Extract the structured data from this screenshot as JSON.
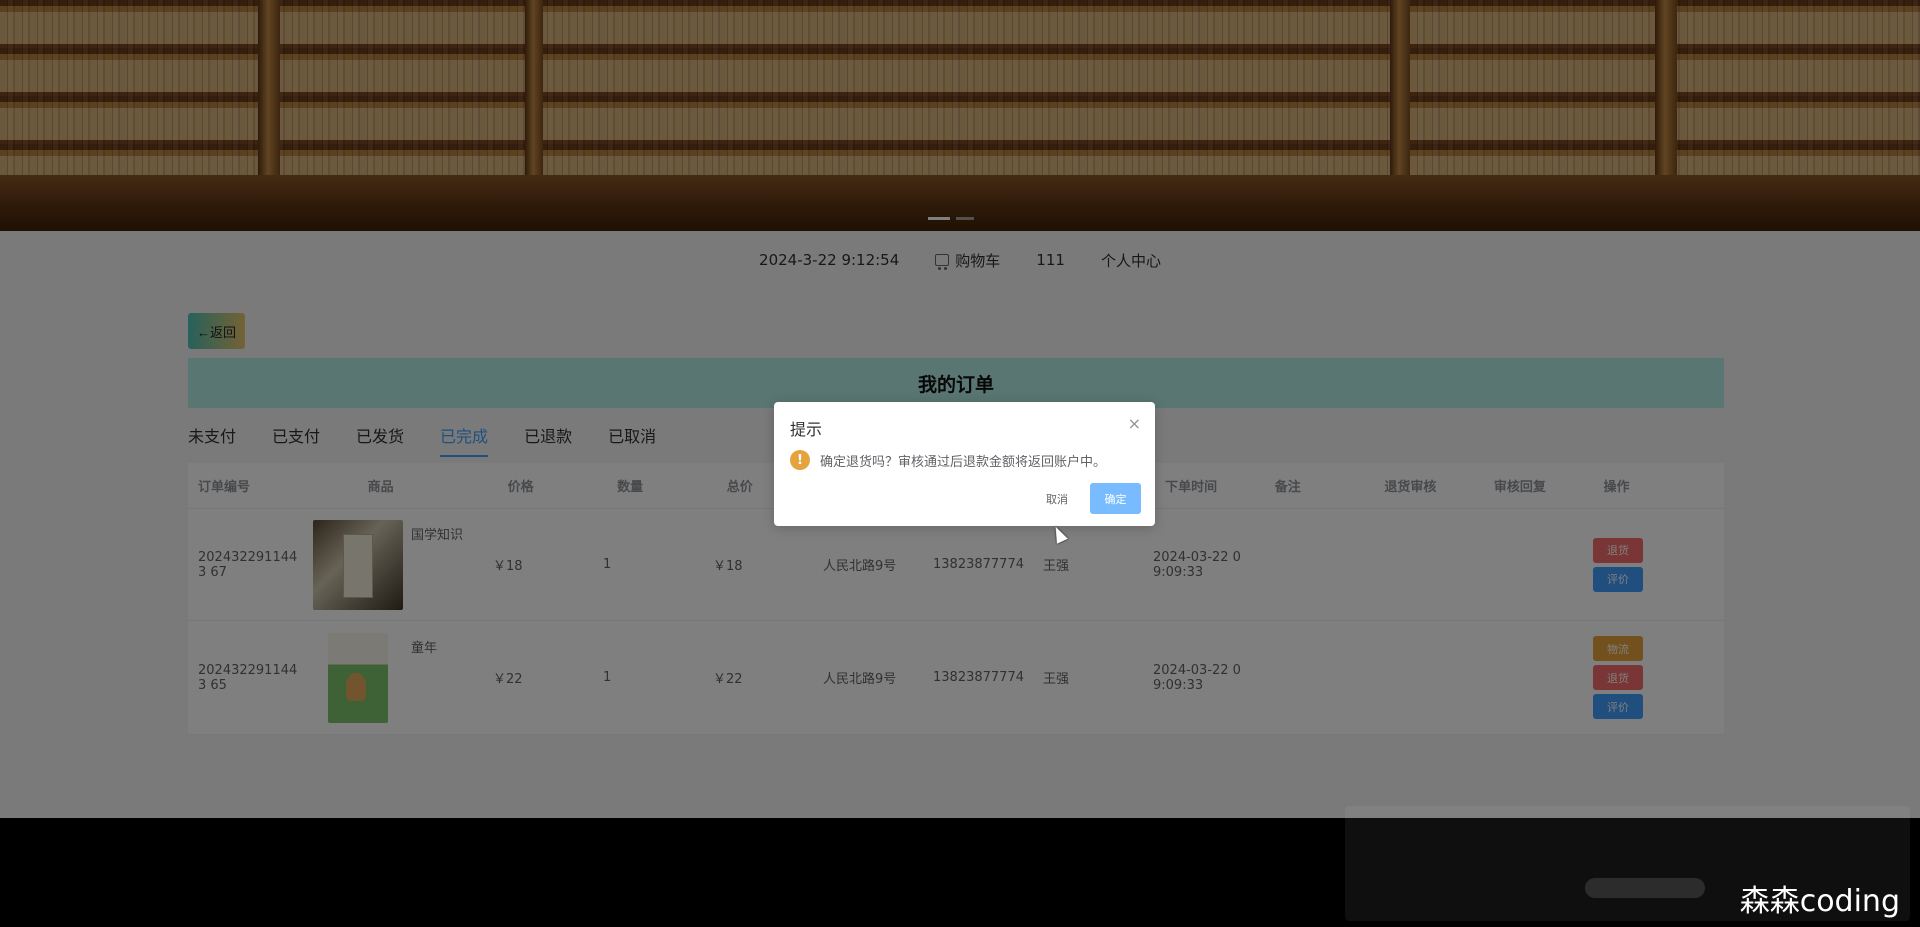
{
  "header": {
    "datetime": "2024-3-22 9:12:54",
    "cart_label": "购物车",
    "username": "111",
    "profile_label": "个人中心"
  },
  "back_label": "←返回",
  "page_title": "我的订单",
  "tabs": [
    {
      "label": "未支付",
      "active": false
    },
    {
      "label": "已支付",
      "active": false
    },
    {
      "label": "已发货",
      "active": false
    },
    {
      "label": "已完成",
      "active": true
    },
    {
      "label": "已退款",
      "active": false
    },
    {
      "label": "已取消",
      "active": false
    }
  ],
  "table": {
    "headers": [
      "订单编号",
      "商品",
      "价格",
      "数量",
      "总价",
      "",
      "",
      "",
      "下单时间",
      "备注",
      "退货审核",
      "审核回复",
      "操作"
    ],
    "rows": [
      {
        "order_no": "2024322911443 67",
        "goods": "国学知识",
        "price": "￥18",
        "qty": "1",
        "total": "￥18",
        "address": "人民北路9号",
        "phone": "13823877774",
        "name": "王强",
        "time": "2024-03-22 0 9:09:33",
        "note": "",
        "return_audit": "",
        "audit_reply": "",
        "actions": [
          "退货",
          "评价"
        ]
      },
      {
        "order_no": "2024322911443 65",
        "goods": "童年",
        "price": "￥22",
        "qty": "1",
        "total": "￥22",
        "address": "人民北路9号",
        "phone": "13823877774",
        "name": "王强",
        "time": "2024-03-22 0 9:09:33",
        "note": "",
        "return_audit": "",
        "audit_reply": "",
        "actions": [
          "物流",
          "退货",
          "评价"
        ]
      }
    ]
  },
  "dialog": {
    "title": "提示",
    "close_icon": "×",
    "warning_icon": "!",
    "message": "确定退货吗？审核通过后退款金额将返回账户中。",
    "cancel_label": "取消",
    "confirm_label": "确定"
  },
  "watermark": "森森coding",
  "colors": {
    "accent": "#409eff",
    "danger": "#f56c6c",
    "warning": "#e6a23c",
    "title_bar": "#b5ede4"
  }
}
